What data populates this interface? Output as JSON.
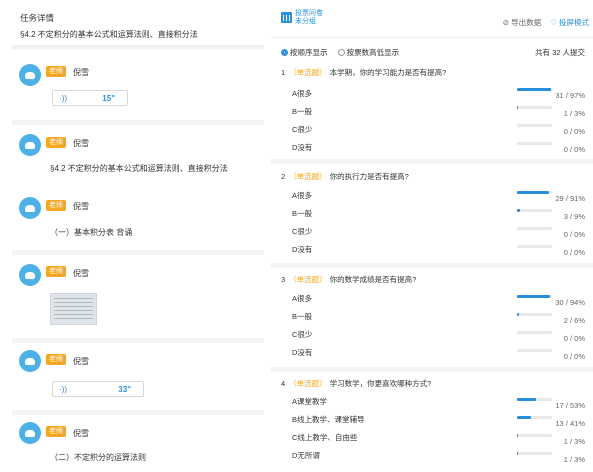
{
  "left": {
    "title": "任务详情",
    "subtitle": "§4.2 不定积分的基本公式和运算法则、直接积分法",
    "messages": [
      {
        "badge": "老师",
        "name": "倪雪",
        "voice": "15\""
      },
      {
        "badge": "老师",
        "name": "倪雪",
        "text": "§4.2  不定积分的基本公式和运算法则、直接积分法"
      },
      {
        "badge": "老师",
        "name": "倪雪",
        "text": "（一）基本积分表  背诵"
      },
      {
        "badge": "老师",
        "name": "倪雪",
        "image": "worksheet-thumbnail"
      },
      {
        "badge": "老师",
        "name": "倪雪",
        "voice": "33\""
      },
      {
        "badge": "老师",
        "name": "倪雪",
        "text": "（二）不定积分的运算法则"
      }
    ]
  },
  "right": {
    "brand_line1": "投票问卷",
    "brand_line2": "未分组",
    "export_label": "⊘ 导出数据",
    "screen_label": "♡ 投屏模式",
    "sort_order": "按顺序显示",
    "sort_votes": "按票数高低显示",
    "total": "共有 32 人提交",
    "questions": [
      {
        "num": "1",
        "type": "（单选题）",
        "text": "本学期，你的学习能力是否有提高?",
        "options": [
          {
            "label": "A很多",
            "count": "31 / 97%",
            "pct": 97
          },
          {
            "label": "B一般",
            "count": "1 / 3%",
            "pct": 3
          },
          {
            "label": "C很少",
            "count": "0 / 0%",
            "pct": 0
          },
          {
            "label": "D没有",
            "count": "0 / 0%",
            "pct": 0
          }
        ]
      },
      {
        "num": "2",
        "type": "（单选题）",
        "text": "你的执行力是否有提高?",
        "options": [
          {
            "label": "A很多",
            "count": "29 / 91%",
            "pct": 91
          },
          {
            "label": "B一般",
            "count": "3 / 9%",
            "pct": 9
          },
          {
            "label": "C很少",
            "count": "0 / 0%",
            "pct": 0
          },
          {
            "label": "D没有",
            "count": "0 / 0%",
            "pct": 0
          }
        ]
      },
      {
        "num": "3",
        "type": "（单选题）",
        "text": "你的数学成绩是否有提高?",
        "options": [
          {
            "label": "A很多",
            "count": "30 / 94%",
            "pct": 94
          },
          {
            "label": "B一般",
            "count": "2 / 6%",
            "pct": 6
          },
          {
            "label": "C很少",
            "count": "0 / 0%",
            "pct": 0
          },
          {
            "label": "D没有",
            "count": "0 / 0%",
            "pct": 0
          }
        ]
      },
      {
        "num": "4",
        "type": "（单选题）",
        "text": "学习数学，你更喜欢哪种方式?",
        "options": [
          {
            "label": "A课堂教学",
            "count": "17 / 53%",
            "pct": 53
          },
          {
            "label": "B线上教学、课堂辅导",
            "count": "13 / 41%",
            "pct": 41
          },
          {
            "label": "C线上教学、自由些",
            "count": "1 / 3%",
            "pct": 3
          },
          {
            "label": "D无所谓",
            "count": "1 / 3%",
            "pct": 3
          }
        ]
      }
    ]
  },
  "colors": {
    "accent": "#2a8fdb",
    "badge": "#f5a623",
    "avatar": "#4db0e6"
  }
}
